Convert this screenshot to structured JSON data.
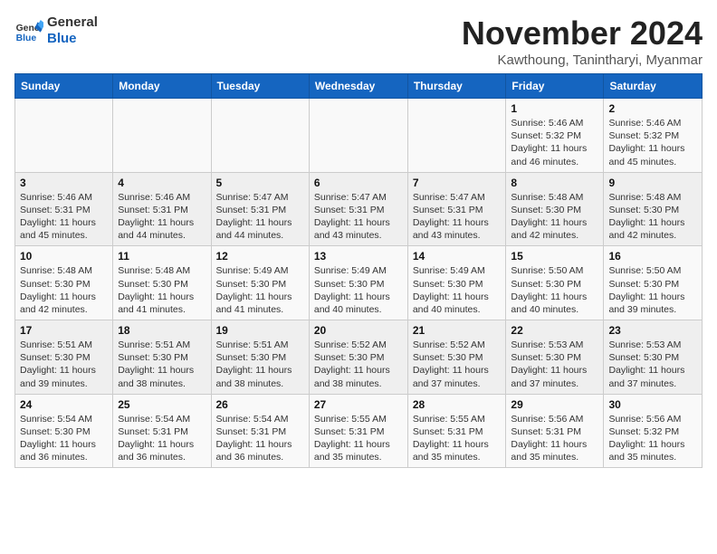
{
  "header": {
    "logo_general": "General",
    "logo_blue": "Blue",
    "month_title": "November 2024",
    "location": "Kawthoung, Tanintharyi, Myanmar"
  },
  "weekdays": [
    "Sunday",
    "Monday",
    "Tuesday",
    "Wednesday",
    "Thursday",
    "Friday",
    "Saturday"
  ],
  "weeks": [
    [
      {
        "day": "",
        "info": ""
      },
      {
        "day": "",
        "info": ""
      },
      {
        "day": "",
        "info": ""
      },
      {
        "day": "",
        "info": ""
      },
      {
        "day": "",
        "info": ""
      },
      {
        "day": "1",
        "info": "Sunrise: 5:46 AM\nSunset: 5:32 PM\nDaylight: 11 hours\nand 46 minutes."
      },
      {
        "day": "2",
        "info": "Sunrise: 5:46 AM\nSunset: 5:32 PM\nDaylight: 11 hours\nand 45 minutes."
      }
    ],
    [
      {
        "day": "3",
        "info": "Sunrise: 5:46 AM\nSunset: 5:31 PM\nDaylight: 11 hours\nand 45 minutes."
      },
      {
        "day": "4",
        "info": "Sunrise: 5:46 AM\nSunset: 5:31 PM\nDaylight: 11 hours\nand 44 minutes."
      },
      {
        "day": "5",
        "info": "Sunrise: 5:47 AM\nSunset: 5:31 PM\nDaylight: 11 hours\nand 44 minutes."
      },
      {
        "day": "6",
        "info": "Sunrise: 5:47 AM\nSunset: 5:31 PM\nDaylight: 11 hours\nand 43 minutes."
      },
      {
        "day": "7",
        "info": "Sunrise: 5:47 AM\nSunset: 5:31 PM\nDaylight: 11 hours\nand 43 minutes."
      },
      {
        "day": "8",
        "info": "Sunrise: 5:48 AM\nSunset: 5:30 PM\nDaylight: 11 hours\nand 42 minutes."
      },
      {
        "day": "9",
        "info": "Sunrise: 5:48 AM\nSunset: 5:30 PM\nDaylight: 11 hours\nand 42 minutes."
      }
    ],
    [
      {
        "day": "10",
        "info": "Sunrise: 5:48 AM\nSunset: 5:30 PM\nDaylight: 11 hours\nand 42 minutes."
      },
      {
        "day": "11",
        "info": "Sunrise: 5:48 AM\nSunset: 5:30 PM\nDaylight: 11 hours\nand 41 minutes."
      },
      {
        "day": "12",
        "info": "Sunrise: 5:49 AM\nSunset: 5:30 PM\nDaylight: 11 hours\nand 41 minutes."
      },
      {
        "day": "13",
        "info": "Sunrise: 5:49 AM\nSunset: 5:30 PM\nDaylight: 11 hours\nand 40 minutes."
      },
      {
        "day": "14",
        "info": "Sunrise: 5:49 AM\nSunset: 5:30 PM\nDaylight: 11 hours\nand 40 minutes."
      },
      {
        "day": "15",
        "info": "Sunrise: 5:50 AM\nSunset: 5:30 PM\nDaylight: 11 hours\nand 40 minutes."
      },
      {
        "day": "16",
        "info": "Sunrise: 5:50 AM\nSunset: 5:30 PM\nDaylight: 11 hours\nand 39 minutes."
      }
    ],
    [
      {
        "day": "17",
        "info": "Sunrise: 5:51 AM\nSunset: 5:30 PM\nDaylight: 11 hours\nand 39 minutes."
      },
      {
        "day": "18",
        "info": "Sunrise: 5:51 AM\nSunset: 5:30 PM\nDaylight: 11 hours\nand 38 minutes."
      },
      {
        "day": "19",
        "info": "Sunrise: 5:51 AM\nSunset: 5:30 PM\nDaylight: 11 hours\nand 38 minutes."
      },
      {
        "day": "20",
        "info": "Sunrise: 5:52 AM\nSunset: 5:30 PM\nDaylight: 11 hours\nand 38 minutes."
      },
      {
        "day": "21",
        "info": "Sunrise: 5:52 AM\nSunset: 5:30 PM\nDaylight: 11 hours\nand 37 minutes."
      },
      {
        "day": "22",
        "info": "Sunrise: 5:53 AM\nSunset: 5:30 PM\nDaylight: 11 hours\nand 37 minutes."
      },
      {
        "day": "23",
        "info": "Sunrise: 5:53 AM\nSunset: 5:30 PM\nDaylight: 11 hours\nand 37 minutes."
      }
    ],
    [
      {
        "day": "24",
        "info": "Sunrise: 5:54 AM\nSunset: 5:30 PM\nDaylight: 11 hours\nand 36 minutes."
      },
      {
        "day": "25",
        "info": "Sunrise: 5:54 AM\nSunset: 5:31 PM\nDaylight: 11 hours\nand 36 minutes."
      },
      {
        "day": "26",
        "info": "Sunrise: 5:54 AM\nSunset: 5:31 PM\nDaylight: 11 hours\nand 36 minutes."
      },
      {
        "day": "27",
        "info": "Sunrise: 5:55 AM\nSunset: 5:31 PM\nDaylight: 11 hours\nand 35 minutes."
      },
      {
        "day": "28",
        "info": "Sunrise: 5:55 AM\nSunset: 5:31 PM\nDaylight: 11 hours\nand 35 minutes."
      },
      {
        "day": "29",
        "info": "Sunrise: 5:56 AM\nSunset: 5:31 PM\nDaylight: 11 hours\nand 35 minutes."
      },
      {
        "day": "30",
        "info": "Sunrise: 5:56 AM\nSunset: 5:32 PM\nDaylight: 11 hours\nand 35 minutes."
      }
    ]
  ]
}
